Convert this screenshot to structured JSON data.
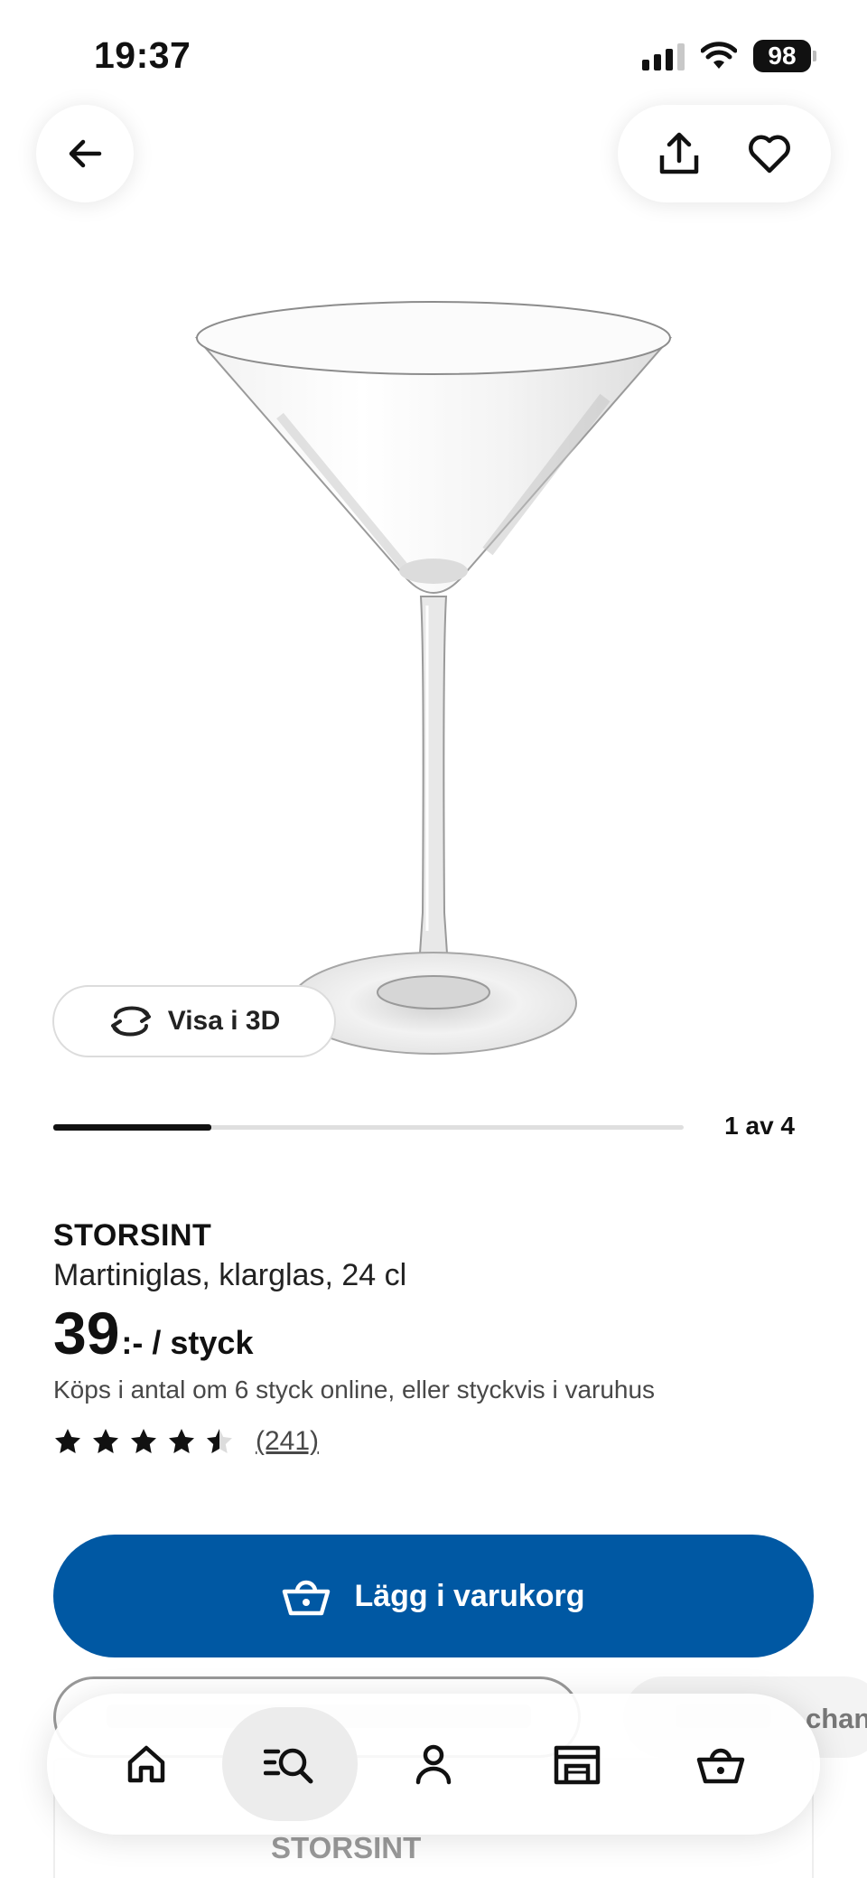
{
  "status_bar": {
    "time": "19:37",
    "battery": "98"
  },
  "product": {
    "brand": "STORSINT",
    "description": "Martiniglas, klarglas, 24 cl",
    "price_integer": "39",
    "price_suffix": ":- / styck",
    "purchase_note": "Köps i antal om 6 styck online, eller styckvis i varuhus",
    "rating": 4.5,
    "rating_count": "(241)"
  },
  "gallery": {
    "view_3d_label": "Visa i 3D",
    "position": "1 av 4",
    "current": 1,
    "total": 4
  },
  "cart": {
    "add_label": "Lägg i varukorg"
  },
  "behind_content": {
    "partial_text": "chan",
    "card_title": "STORSINT"
  },
  "bottom_nav": {
    "items": [
      {
        "name": "home-icon",
        "active": false
      },
      {
        "name": "search-icon",
        "active": true
      },
      {
        "name": "profile-icon",
        "active": false
      },
      {
        "name": "store-icon",
        "active": false
      },
      {
        "name": "basket-icon",
        "active": false
      }
    ]
  },
  "colors": {
    "primary_blue": "#0058a3",
    "text": "#111111",
    "muted": "#484848"
  }
}
